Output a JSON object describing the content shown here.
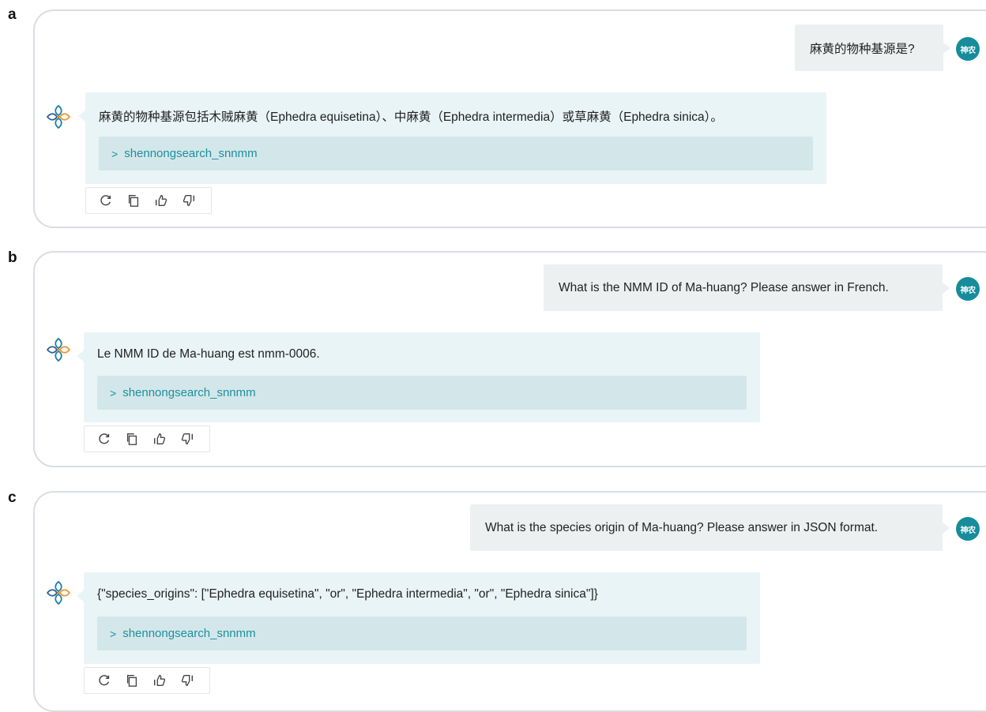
{
  "panels": [
    {
      "letter": "a",
      "user_message": "麻黄的物种基源是?",
      "user_avatar": "神农",
      "bot_answer": "麻黄的物种基源包括木贼麻黄（Ephedra equisetina）、中麻黄（Ephedra intermedia）或草麻黄（Ephedra sinica）。",
      "tool_label": "shennongsearch_snnmm"
    },
    {
      "letter": "b",
      "user_message": "What is the NMM ID of Ma-huang? Please answer in French.",
      "user_avatar": "神农",
      "bot_answer": "Le NMM ID de Ma-huang est nmm-0006.",
      "tool_label": "shennongsearch_snnmm"
    },
    {
      "letter": "c",
      "user_message": "What is the species origin of Ma-huang? Please answer in JSON format.",
      "user_avatar": "神农",
      "bot_answer": "{\"species_origins\": [\"Ephedra equisetina\", \"or\", \"Ephedra intermedia\", \"or\", \"Ephedra sinica\"]}",
      "tool_label": "shennongsearch_snnmm"
    }
  ],
  "icons": {
    "tool_expand": "chevron-right-icon",
    "actions": [
      "refresh-icon",
      "copy-icon",
      "thumbs-up-icon",
      "thumbs-down-icon"
    ],
    "bot_logo": "shennong-logo-icon"
  },
  "colors": {
    "avatar": "#178c9b",
    "user_bubble": "#ecf0f1",
    "bot_bubble": "#e9f4f6",
    "tool_bar": "#d3e7ea",
    "tool_text": "#1c8f9d",
    "panel_border": "#d9dce1"
  }
}
